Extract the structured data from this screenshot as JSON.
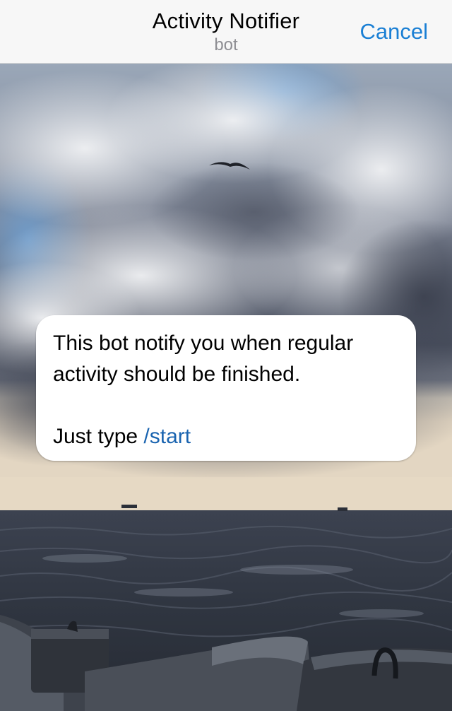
{
  "header": {
    "title": "Activity Notifier",
    "subtitle": "bot",
    "cancel_label": "Cancel"
  },
  "message": {
    "line1": "This bot notify you when regular",
    "line2": "activity should be finished.",
    "prefix": "Just type ",
    "command": "/start"
  },
  "colors": {
    "accent": "#1a7fd4",
    "command_link": "#1a64b0",
    "navbar_bg": "#f7f7f7"
  },
  "background": {
    "description_icon": "sea-sky-photo"
  }
}
